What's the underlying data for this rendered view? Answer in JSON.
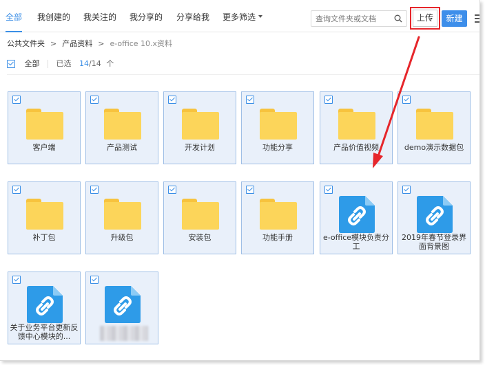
{
  "tabs": [
    {
      "label": "全部",
      "active": true
    },
    {
      "label": "我创建的"
    },
    {
      "label": "我关注的"
    },
    {
      "label": "我分享的"
    },
    {
      "label": "分享给我"
    },
    {
      "label": "更多筛选"
    }
  ],
  "search": {
    "placeholder": "查询文件夹或文档",
    "icon": "search-icon"
  },
  "toolbar": {
    "upload_label": "上传",
    "new_label": "新建",
    "highlight_color": "#e6262b",
    "accent": "#3d8eea"
  },
  "breadcrumb": {
    "items": [
      "公共文件夹",
      "产品资料"
    ],
    "current": "e-office 10.x资料"
  },
  "selection": {
    "all_label": "全部",
    "selected_label": "已选",
    "selected_count": "14",
    "total": "/14",
    "unit": "个"
  },
  "items": [
    {
      "name": "客户端",
      "type": "folder"
    },
    {
      "name": "产品测试",
      "type": "folder"
    },
    {
      "name": "开发计划",
      "type": "folder"
    },
    {
      "name": "功能分享",
      "type": "folder"
    },
    {
      "name": "产品价值视频",
      "type": "folder"
    },
    {
      "name": "demo演示数据包",
      "type": "folder"
    },
    {
      "name": "补丁包",
      "type": "folder"
    },
    {
      "name": "升级包",
      "type": "folder"
    },
    {
      "name": "安装包",
      "type": "folder"
    },
    {
      "name": "功能手册",
      "type": "folder"
    },
    {
      "name": "e-office模块负责分工",
      "type": "link"
    },
    {
      "name": "2019年春节登录界面背景图",
      "type": "link"
    },
    {
      "name": "关于业务平台更新反馈中心模块的...",
      "type": "link"
    },
    {
      "name": "",
      "type": "link",
      "blurred": true
    }
  ]
}
